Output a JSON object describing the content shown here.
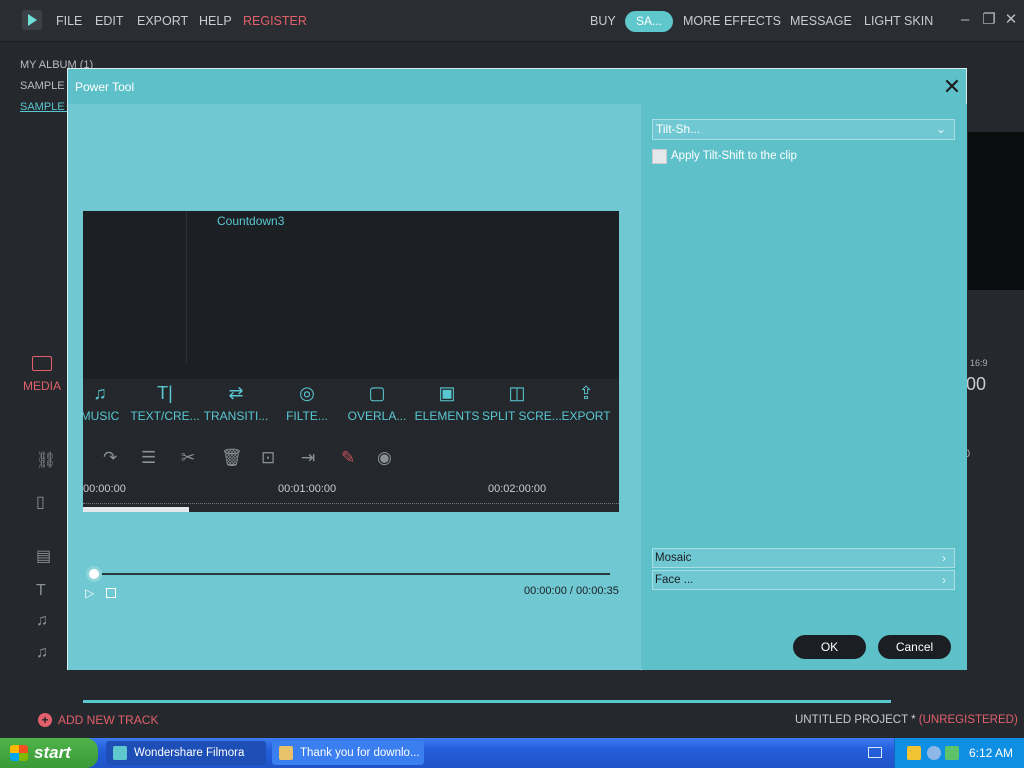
{
  "menu": {
    "file": "FILE",
    "edit": "EDIT",
    "export": "EXPORT",
    "help": "HELP",
    "register": "REGISTER",
    "buy": "BUY",
    "sa": "SA...",
    "more_effects": "MORE EFFECTS",
    "message": "MESSAGE",
    "light_skin": "LIGHT SKIN"
  },
  "left_panel": {
    "items": [
      "MY ALBUM (1)",
      "SAMPLE C",
      "SAMPLE V"
    ],
    "media_tab": "MEDIA"
  },
  "background": {
    "ratio": "16:9",
    "time": "00",
    "timeline_zero": "0"
  },
  "bottom": {
    "add_track": "ADD NEW TRACK",
    "project_name": "UNTITLED PROJECT *",
    "project_status": "(UNREGISTERED)"
  },
  "dialog": {
    "title": "Power Tool",
    "close": "✕",
    "clip": {
      "title": "Countdown3",
      "tabs": [
        {
          "icon": "♫",
          "label": "MUSIC"
        },
        {
          "icon": "T|",
          "label": "TEXT/CRE..."
        },
        {
          "icon": "⇄",
          "label": "TRANSITI..."
        },
        {
          "icon": "◎",
          "label": "FILTE..."
        },
        {
          "icon": "▢",
          "label": "OVERLA..."
        },
        {
          "icon": "▣",
          "label": "ELEMENTS"
        },
        {
          "icon": "◫",
          "label": "SPLIT SCRE..."
        },
        {
          "icon": "⇪",
          "label": "EXPORT"
        }
      ],
      "ruler": [
        "00:00:00",
        "00:01:00:00",
        "00:02:00:00"
      ]
    },
    "playback": {
      "play": "▷",
      "time": "00:00:00 / 00:00:35"
    },
    "tilt_select": "Tilt-Sh...",
    "apply_label": "Apply Tilt-Shift to the clip",
    "apply_checked": false,
    "fx_rows": [
      "Mosaic",
      "Face ..."
    ],
    "ok": "OK",
    "cancel": "Cancel"
  },
  "taskbar": {
    "start": "start",
    "tasks": [
      "Wondershare Filmora",
      "Thank you for downlo..."
    ],
    "clock": "6:12 AM"
  },
  "colors": {
    "accent": "#5ec8cd",
    "dialog_bg": "#5ec1ca",
    "register": "#e2606b"
  }
}
